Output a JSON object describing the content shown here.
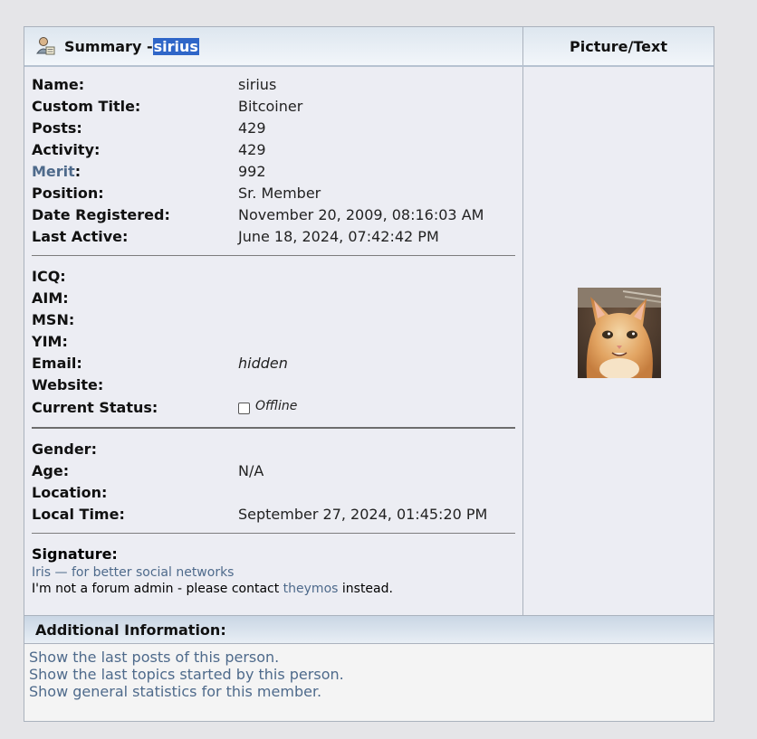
{
  "summary": {
    "title": "Summary - ",
    "username": "sirius",
    "picture_header": "Picture/Text"
  },
  "profile": {
    "name": {
      "label": "Name:",
      "value": "sirius"
    },
    "custom_title": {
      "label": "Custom Title:",
      "value": "Bitcoiner"
    },
    "posts": {
      "label": "Posts:",
      "value": "429"
    },
    "activity": {
      "label": "Activity:",
      "value": "429"
    },
    "merit": {
      "label": "Merit",
      "colon": ":",
      "value": "992"
    },
    "position": {
      "label": "Position:",
      "value": "Sr. Member"
    },
    "date_registered": {
      "label": "Date Registered:",
      "value": "November 20, 2009, 08:16:03 AM"
    },
    "last_active": {
      "label": "Last Active:",
      "value": "June 18, 2024, 07:42:42 PM"
    }
  },
  "contacts": {
    "icq": {
      "label": "ICQ:",
      "value": ""
    },
    "aim": {
      "label": "AIM:",
      "value": ""
    },
    "msn": {
      "label": "MSN:",
      "value": ""
    },
    "yim": {
      "label": "YIM:",
      "value": ""
    },
    "email": {
      "label": "Email:",
      "value": "hidden"
    },
    "website": {
      "label": "Website:",
      "value": ""
    },
    "status": {
      "label": "Current Status:",
      "value": "Offline"
    }
  },
  "personal": {
    "gender": {
      "label": "Gender:",
      "value": ""
    },
    "age": {
      "label": "Age:",
      "value": "N/A"
    },
    "location": {
      "label": "Location:",
      "value": ""
    },
    "local_time": {
      "label": "Local Time:",
      "value": "September 27, 2024, 01:45:20 PM"
    }
  },
  "signature": {
    "label": "Signature:",
    "line1_link": "Iris — for better social networks",
    "line2_before": "I'm not a forum admin - please contact ",
    "line2_link": "theymos",
    "line2_after": " instead."
  },
  "additional": {
    "title": "Additional Information:",
    "links": [
      "Show the last posts of this person.",
      "Show the last topics started by this person.",
      "Show general statistics for this member."
    ]
  },
  "icons": {
    "summary_icon": "user-profile-icon",
    "status_icon": "offline-status-icon",
    "avatar": "kitten-avatar"
  }
}
